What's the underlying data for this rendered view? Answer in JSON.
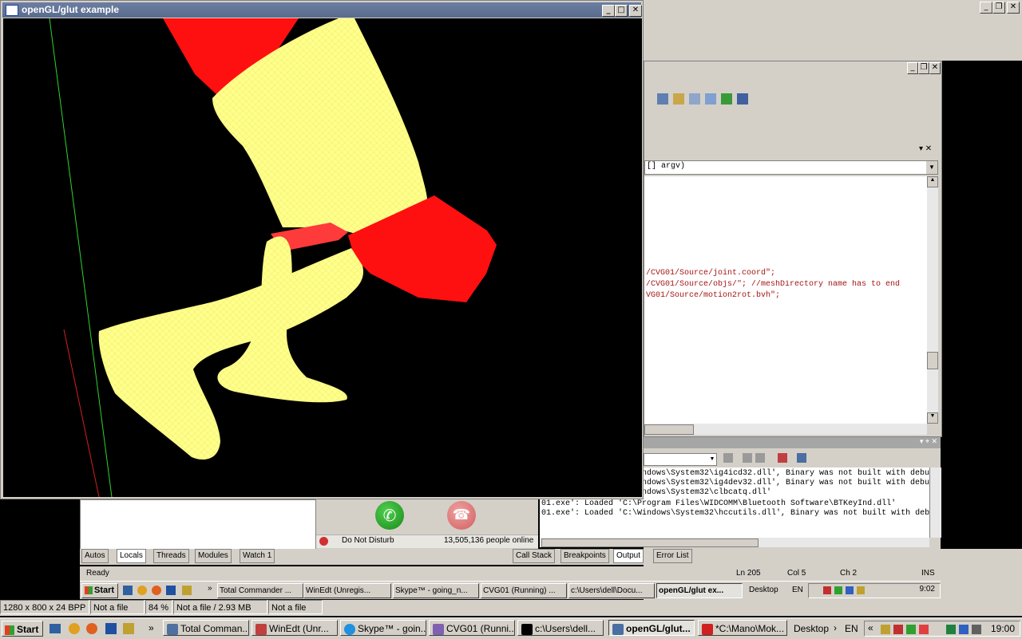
{
  "gl_window": {
    "title": "openGL/glut example",
    "min": "_",
    "max": "□",
    "close": "✕"
  },
  "ide": {
    "function_combo": "[] argv)",
    "code_lines": [
      "/CVG01/Source/joint.coord\";",
      "/CVG01/Source/objs/\"; //meshDirectory name has to end",
      "VG01/Source/motion2rot.bvh\";"
    ],
    "output_lines": [
      "ndows\\System32\\ig4icd32.dll', Binary was not built with debug",
      "ndows\\System32\\ig4dev32.dll', Binary was not built with debug",
      "ndows\\System32\\clbcatq.dll'",
      "01.exe': Loaded 'C:\\Program Files\\WIDCOMM\\Bluetooth Software\\BTKeyInd.dll'",
      "01.exe': Loaded 'C:\\Windows\\System32\\hccutils.dll', Binary was not built with debug"
    ],
    "bottom_tabs_left": [
      "Autos",
      "Locals",
      "Threads",
      "Modules",
      "Watch 1"
    ],
    "bottom_tabs_right": [
      "Call Stack",
      "Breakpoints",
      "Output",
      "Error List"
    ],
    "status": {
      "ready": "Ready",
      "ln": "Ln 205",
      "col": "Col 5",
      "ch": "Ch 2",
      "ins": "INS"
    }
  },
  "skype": {
    "status": "Do Not Disturb",
    "online": "13,505,136 people online"
  },
  "inner_taskbar": {
    "start": "Start",
    "buttons": [
      "Total Commander ...",
      "WinEdt  (Unregis...",
      "Skype™ - going_n...",
      "CVG01 (Running) ...",
      "c:\\Users\\dell\\Docu...",
      "openGL/glut ex..."
    ],
    "desktop": "Desktop",
    "lang": "EN",
    "clock": "9:02"
  },
  "viewer_status": {
    "dims": "1280 x 800 x 24 BPP",
    "file1": "Not a file",
    "zoom": "84 %",
    "file2": "Not a file / 2.93 MB",
    "file3": "Not a file"
  },
  "taskbar": {
    "start": "Start",
    "buttons": [
      "Total Comman...",
      "WinEdt  (Unr...",
      "Skype™ - goin...",
      "CVG01 (Runni...",
      "c:\\Users\\dell...",
      "openGL/glut...",
      "*C:\\Mano\\Mok..."
    ],
    "desktop": "Desktop",
    "lang": "EN",
    "clock": "19:00"
  }
}
